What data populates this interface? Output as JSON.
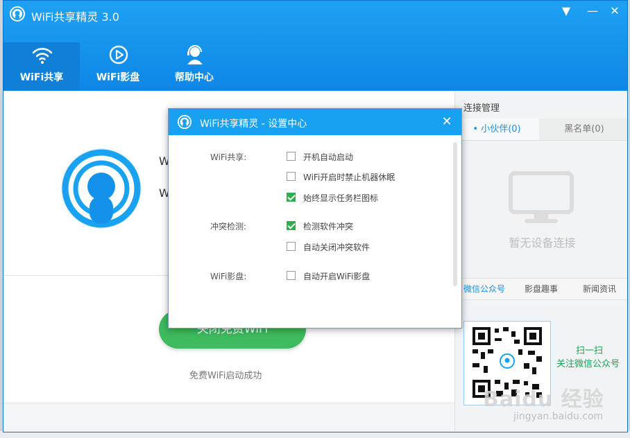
{
  "app": {
    "title": "WiFi共享精灵 3.0",
    "window_buttons": {
      "menu": "▼",
      "minimize": "—",
      "close": "✕"
    }
  },
  "tabs": [
    {
      "label": "WiFi共享",
      "icon": "wifi-icon",
      "active": true
    },
    {
      "label": "WiFi影盘",
      "icon": "play-circle-icon",
      "active": false
    },
    {
      "label": "帮助中心",
      "icon": "support-agent-icon",
      "active": false
    }
  ],
  "main": {
    "info_line_1": "W",
    "info_line_2": "W",
    "close_wifi_button": "关闭免费WiFi",
    "status": "免费WiFi启动成功"
  },
  "right_panel": {
    "title": "连接管理",
    "subtabs": [
      {
        "label": "• 小伙伴(0)",
        "active": true
      },
      {
        "label": "黑名单(0)",
        "active": false
      }
    ],
    "empty_message": "暂无设备连接",
    "bottom_tabs": [
      {
        "label": "微信公众号",
        "active": true
      },
      {
        "label": "影盘趣事",
        "active": false
      },
      {
        "label": "新闻资讯",
        "active": false
      }
    ],
    "qr_line_1": "扫一扫",
    "qr_line_2": "关注微信公众号"
  },
  "watermark": {
    "text": "Baidu 经验",
    "url": "jingyan.baidu.com"
  },
  "dialog": {
    "title": "WiFi共享精灵 - 设置中心",
    "sections": [
      {
        "label": "WiFi共享:",
        "options": [
          {
            "label": "开机自动启动",
            "checked": false
          },
          {
            "label": "WiFi开启时禁止机器休眠",
            "checked": false
          },
          {
            "label": "始终显示任务栏图标",
            "checked": true
          }
        ]
      },
      {
        "label": "冲突检测:",
        "options": [
          {
            "label": "检测软件冲突",
            "checked": true
          },
          {
            "label": "自动关闭冲突软件",
            "checked": false
          }
        ]
      },
      {
        "label": "WiFi影盘:",
        "options": [
          {
            "label": "自动开启WiFi影盘",
            "checked": false
          }
        ]
      }
    ]
  },
  "colors": {
    "brand_blue": "#17a1f0",
    "green": "#3dbb5e",
    "link_blue": "#1a8fe3"
  }
}
